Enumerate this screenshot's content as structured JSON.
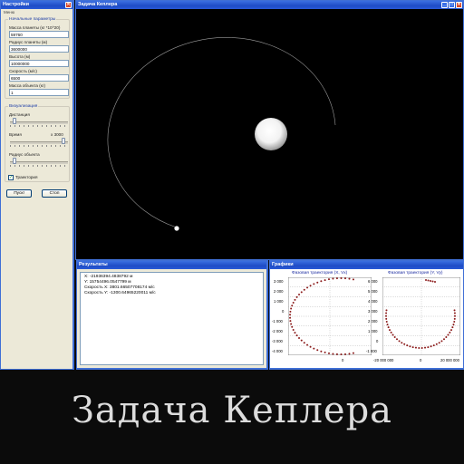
{
  "settings": {
    "window_title": "Настройки",
    "menu_label": "Меню",
    "params_group": "Начальные параметры",
    "fields": [
      {
        "label": "Масса планеты (кг *10^20)",
        "value": "59760"
      },
      {
        "label": "Радиус планеты (м)",
        "value": "3600000"
      },
      {
        "label": "Высота (м)",
        "value": "10000000"
      },
      {
        "label": "Скорость (м/с)",
        "value": "6500"
      },
      {
        "label": "Масса объекта (кг)",
        "value": "1"
      }
    ],
    "viz_group": "Визуализация",
    "distance_label": "Дистанция",
    "distance_level": 0.05,
    "time_label": "Время",
    "time_multiplier": "x 3000",
    "time_level": 0.95,
    "radius_label": "Радиус объекта",
    "radius_level": 0.05,
    "trajectory_label": "Траектория",
    "trajectory_checked": true,
    "start_button": "Пуск!",
    "stop_button": "Стоп"
  },
  "sim": {
    "window_title": "Задача Кеплера"
  },
  "results": {
    "window_title": "Результаты",
    "lines": [
      "X: -21936394.4838792 м",
      "Y: 15754496.0547799 м",
      "Скорость X: 3801.66507708174 м/с",
      "Скорость Y: -1300.64965220011 м/с"
    ]
  },
  "graphs": {
    "window_title": "Графики",
    "plot1_title": "Фазовая траектория (X, Vx)",
    "plot2_title": "Фазовая траектория (Y, Vy)",
    "plot1_yticks": [
      "3 000",
      "2 000",
      "1 000",
      "0",
      "-1 000",
      "-2 000",
      "-3 000",
      "-4 000"
    ],
    "plot1_xticks": [
      "0"
    ],
    "plot2_yticks": [
      "6 000",
      "5 000",
      "4 000",
      "3 000",
      "2 000",
      "1 000",
      "0",
      "-1 000"
    ],
    "plot2_xticks": [
      "-20 000 000",
      "0",
      "20 000 000"
    ],
    "marker_color": "#8b1a1a"
  },
  "caption": "Задача Кеплера"
}
